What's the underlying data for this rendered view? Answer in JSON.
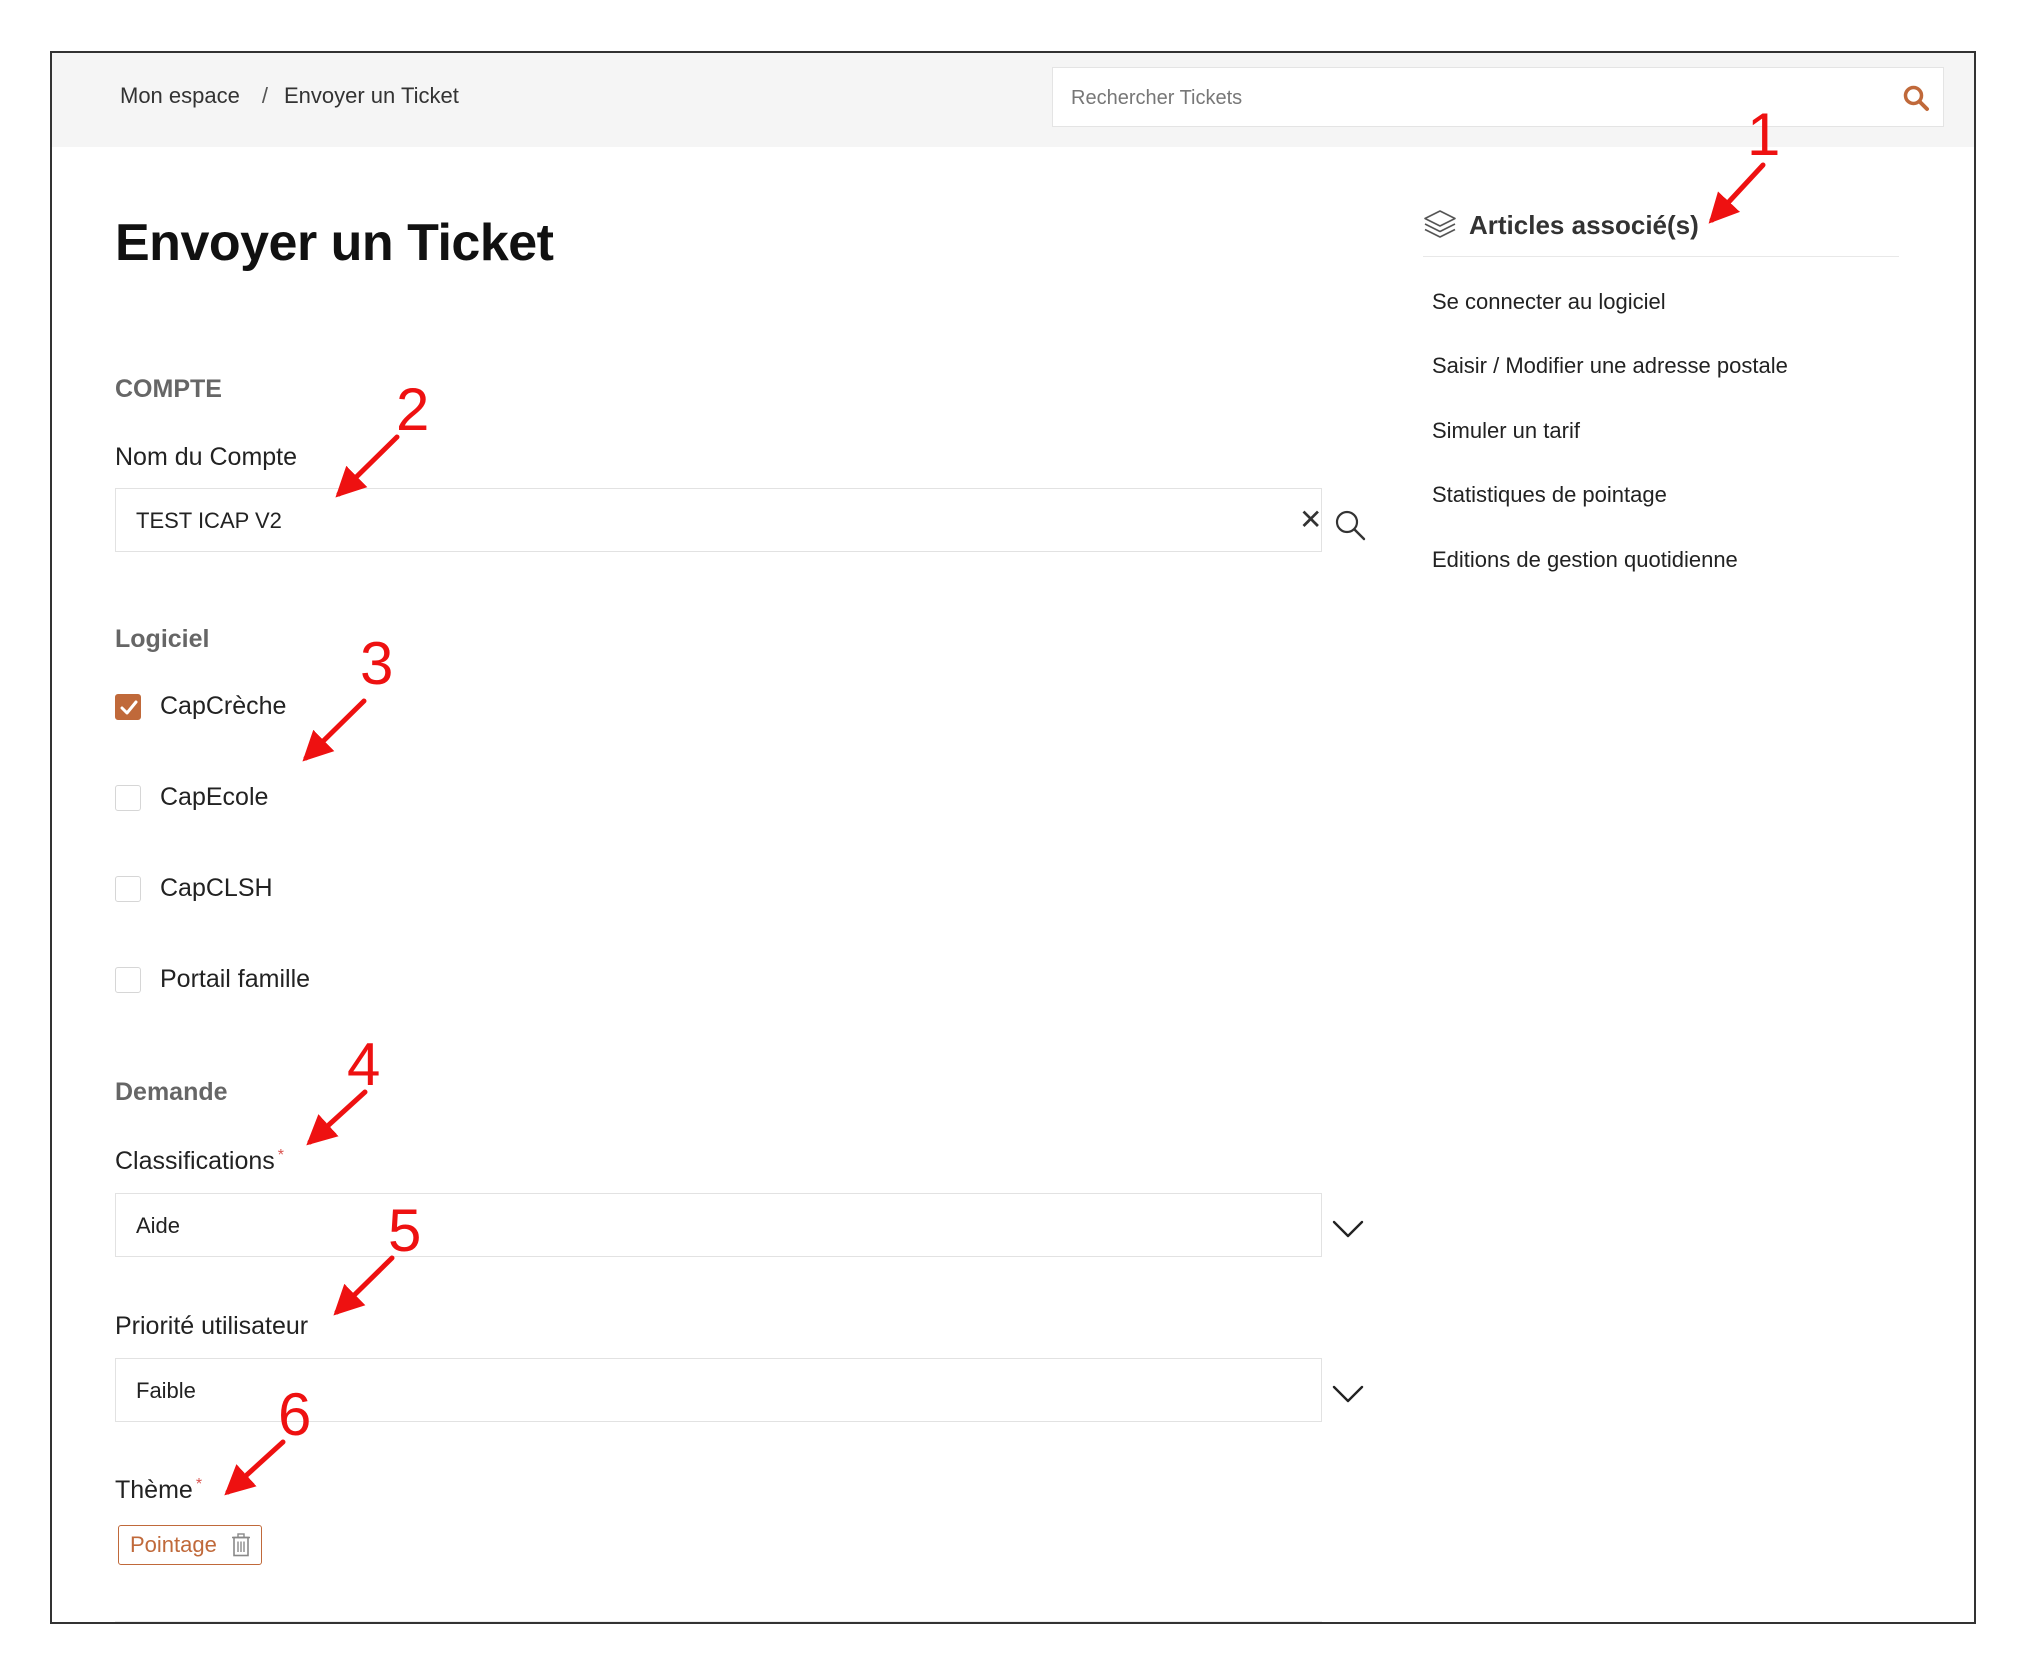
{
  "breadcrumb": {
    "home": "Mon espace",
    "separator": "/",
    "current": "Envoyer un Ticket"
  },
  "search": {
    "placeholder": "Rechercher Tickets"
  },
  "page": {
    "title": "Envoyer un Ticket"
  },
  "form": {
    "compte": {
      "section_title": "COMPTE",
      "nom_label": "Nom du Compte",
      "nom_value": "TEST ICAP V2",
      "clear_glyph": "✕"
    },
    "logiciel": {
      "section_title": "Logiciel",
      "options": [
        {
          "label": "CapCrèche",
          "checked": true
        },
        {
          "label": "CapEcole",
          "checked": false
        },
        {
          "label": "CapCLSH",
          "checked": false
        },
        {
          "label": "Portail famille",
          "checked": false
        }
      ]
    },
    "demande": {
      "section_title": "Demande",
      "classifications_label": "Classifications",
      "classifications_value": "Aide",
      "priorite_label": "Priorité utilisateur",
      "priorite_value": "Faible",
      "theme_label": "Thème",
      "theme_tag": "Pointage",
      "required_mark": "*"
    }
  },
  "sidebar": {
    "title": "Articles associé(s)",
    "articles": [
      "Se connecter au logiciel",
      "Saisir / Modifier une adresse postale",
      "Simuler un tarif",
      "Statistiques de pointage",
      "Editions de gestion quotidienne"
    ]
  },
  "annotations": [
    "1",
    "2",
    "3",
    "4",
    "5",
    "6"
  ],
  "colors": {
    "accent": "#c0693a",
    "annotation": "#ee1111",
    "required": "#d9534f",
    "topbar": "#f5f5f5"
  }
}
